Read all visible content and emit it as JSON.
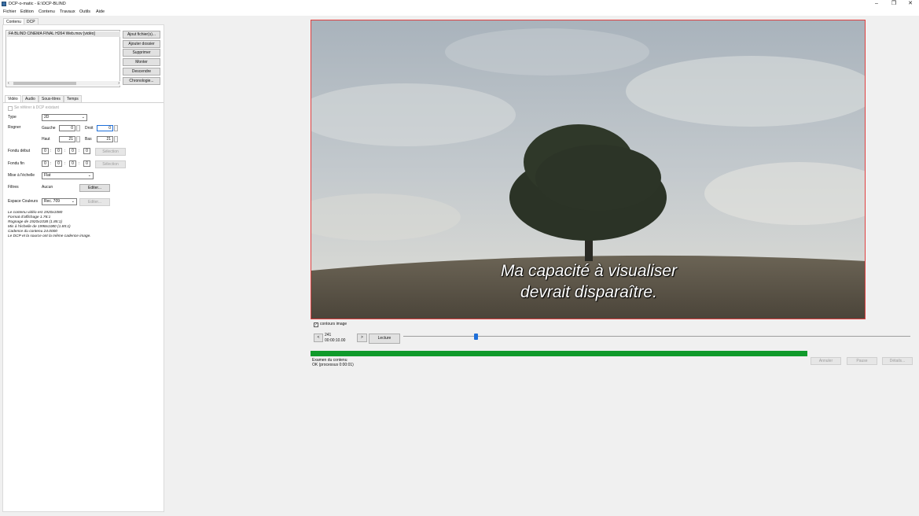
{
  "window": {
    "title": "DCP-o-matic - E:\\DCP-BLIND",
    "minimize": "–",
    "maximize": "❐",
    "close": "✕"
  },
  "menu": [
    "Fichier",
    "Edition",
    "Contenu",
    "Travaux",
    "Outils",
    "Aide"
  ],
  "top_tabs": [
    "Contenu",
    "DCP"
  ],
  "content_list": {
    "items": [
      "FA BLIND CINEMA FINAL H264 Web.mov [vidéo]"
    ]
  },
  "content_buttons": [
    "Ajout fichier(s)...",
    "Ajouter dossier",
    "Supprimer",
    "Monter",
    "Descendre",
    "Chronologie..."
  ],
  "sub_tabs": [
    "Vidéo",
    "Audio",
    "Sous-titres",
    "Temps"
  ],
  "video": {
    "refer_label": "Se référer à DCP existant",
    "type_label": "Type",
    "type_value": "2D",
    "crop_label": "Rogner",
    "left_label": "Gauche",
    "left_value": "0",
    "right_label": "Droit",
    "right_value": "0",
    "top_label": "Haut",
    "top_value": "21",
    "bottom_label": "Bas",
    "bottom_value": "21",
    "fade_in_label": "Fondu début",
    "fade_out_label": "Fondu fin",
    "fade_fields": [
      "0",
      "0",
      "0",
      "0"
    ],
    "select_label": "Sélection",
    "scale_label": "Mise à l'échelle",
    "scale_value": "Flat",
    "filters_label": "Filtres",
    "filters_value": "Aucun",
    "edit_label": "Editer...",
    "colour_label": "Espace Couleurs",
    "colour_value": "Rec. 709",
    "colour_edit": "Editer...",
    "info_lines": [
      "Le contenu vidéo est 1920x1080",
      "Format d'affichage 1.78:1",
      "Rognage de 1920x1038 (1.85:1)",
      "Mis à l'échelle de 1998x1080 (1.85:1)",
      "Cadence du contenu 24.0000",
      "Le DCP et la source ont la même cadence image."
    ]
  },
  "preview": {
    "subtitle_line1": "Ma capacité à visualiser",
    "subtitle_line2": "devrait disparaître.",
    "outline_label": "contours image",
    "prev_btn": "<",
    "next_btn": ">",
    "frame": "241",
    "timecode": "00:00:10.00",
    "play_btn": "Lecture",
    "seek_position": 0.143
  },
  "job": {
    "progress": 1.0,
    "title": "Examen du contenu",
    "status": "OK (processus 0:00:01)",
    "cancel": "Annuler",
    "pause": "Pause",
    "details": "Détails..."
  },
  "colors": {
    "progress": "#109a2b",
    "preview_border": "#e04040",
    "slider_thumb": "#1e6fd9"
  }
}
